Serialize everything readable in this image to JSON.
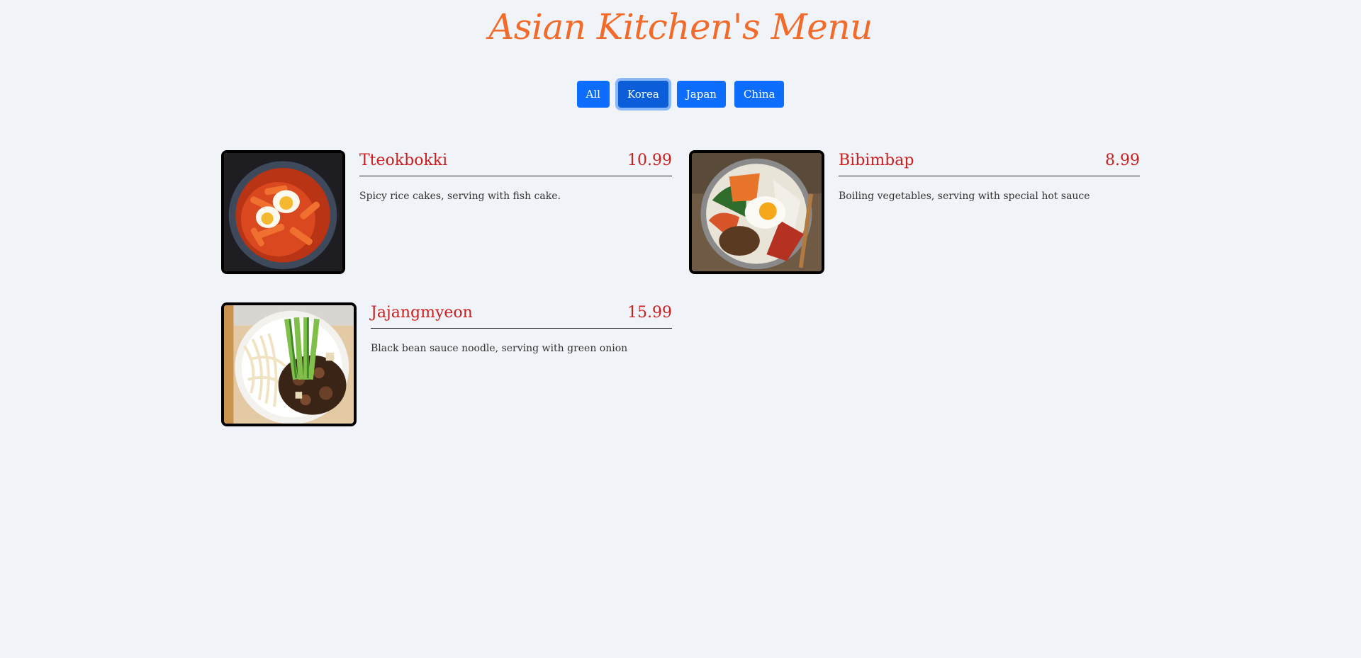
{
  "title": "Asian Kitchen's Menu",
  "filters": [
    {
      "label": "All",
      "active": false
    },
    {
      "label": "Korea",
      "active": true
    },
    {
      "label": "Japan",
      "active": false
    },
    {
      "label": "China",
      "active": false
    }
  ],
  "items": [
    {
      "name": "Tteokbokki",
      "price": "10.99",
      "description": "Spicy rice cakes, serving with fish cake.",
      "image_icon": "tteokbokki-photo"
    },
    {
      "name": "Bibimbap",
      "price": "8.99",
      "description": "Boiling vegetables, serving with special hot sauce",
      "image_icon": "bibimbap-photo"
    },
    {
      "name": "Jajangmyeon",
      "price": "15.99",
      "description": "Black bean sauce noodle, serving with green onion",
      "image_icon": "jajangmyeon-photo"
    }
  ],
  "colors": {
    "title": "#f26b2a",
    "item_text": "#cc1f1f",
    "button": "#0d6efd",
    "background": "#f0f3f7"
  }
}
